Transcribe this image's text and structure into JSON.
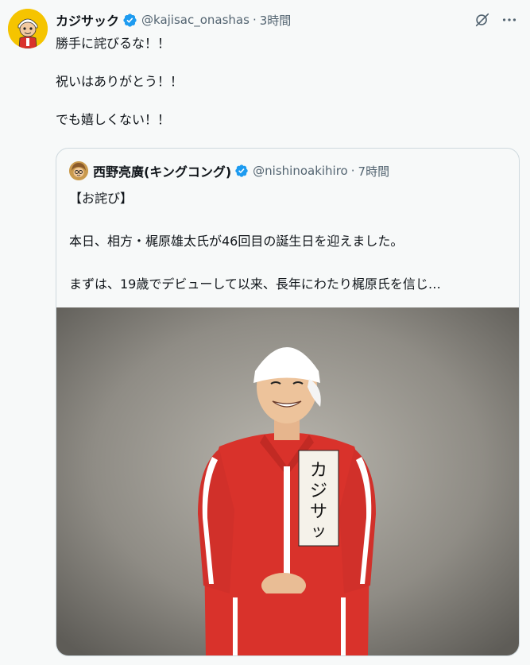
{
  "tweet": {
    "display_name": "カジサック",
    "handle": "@kajisac_onashas",
    "separator": "·",
    "time": "3時間",
    "lines": [
      "勝手に詫びるな！！",
      "祝いはありがとう！！",
      "でも嬉しくない！！"
    ],
    "avatar_icon": "cartoon-avatar-icon",
    "verified_color": "#1d9bf0"
  },
  "actions": {
    "grok_icon": "grok-icon",
    "more_icon": "more-options-icon"
  },
  "quote": {
    "display_name": "西野亮廣(キングコング)",
    "handle": "@nishinoakihiro",
    "separator": "·",
    "time": "7時間",
    "lines": [
      "【お詫び】",
      "本日、相方・梶原雄太氏が46回目の誕生日を迎えました。",
      "まずは、19歳でデビューして以来、長年にわたり梶原氏を信じ…"
    ],
    "media": {
      "jacket_text": "カジサック",
      "jacket_color": "#d9322b",
      "background_color": "#8f8c85"
    }
  }
}
